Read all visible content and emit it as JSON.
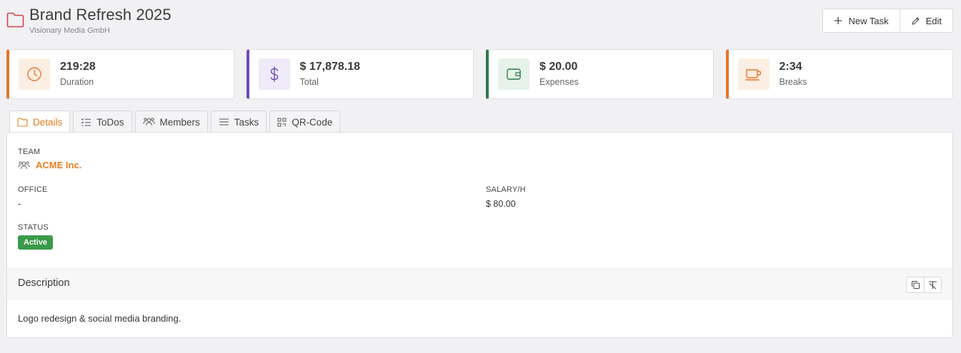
{
  "header": {
    "title": "Brand Refresh 2025",
    "subtitle": "Visionary Media GmbH",
    "new_task_label": "New Task",
    "edit_label": "Edit"
  },
  "stats": [
    {
      "value": "219:28",
      "label": "Duration",
      "color": "#e8742a",
      "icon": "clock-icon"
    },
    {
      "value": "$ 17,878.18",
      "label": "Total",
      "color": "#6b4bb8",
      "icon": "dollar-icon"
    },
    {
      "value": "$ 20.00",
      "label": "Expenses",
      "color": "#2f7a4a",
      "icon": "wallet-icon"
    },
    {
      "value": "2:34",
      "label": "Breaks",
      "color": "#e8742a",
      "icon": "coffee-icon"
    }
  ],
  "tabs": [
    {
      "label": "Details",
      "active": true
    },
    {
      "label": "ToDos"
    },
    {
      "label": "Members"
    },
    {
      "label": "Tasks"
    },
    {
      "label": "QR-Code"
    }
  ],
  "details": {
    "team_label": "TEAM",
    "team_value": "ACME Inc.",
    "office_label": "OFFICE",
    "office_value": "-",
    "salary_label": "SALARY/H",
    "salary_value": "$ 80.00",
    "status_label": "STATUS",
    "status_value": "Active"
  },
  "description": {
    "title": "Description",
    "text": "Logo redesign & social media branding."
  },
  "colors": {
    "accent": "#e67e22",
    "status_active": "#3a9a4a"
  }
}
